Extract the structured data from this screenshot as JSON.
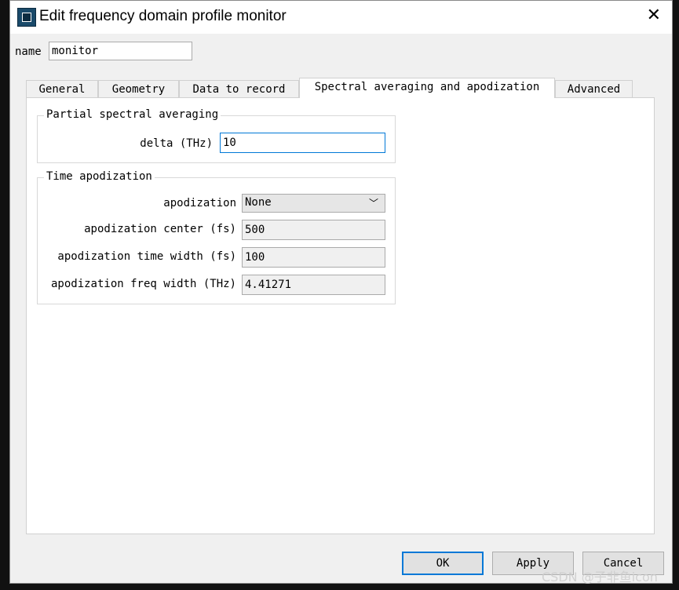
{
  "window": {
    "title": "Edit frequency domain profile monitor"
  },
  "name_field": {
    "label": "name",
    "value": "monitor"
  },
  "tabs": [
    {
      "label": "General"
    },
    {
      "label": "Geometry"
    },
    {
      "label": "Data to record"
    },
    {
      "label": "Spectral averaging and apodization",
      "active": true
    },
    {
      "label": "Advanced"
    }
  ],
  "partial": {
    "title": "Partial spectral averaging",
    "delta_label": "delta (THz)",
    "delta_value": "10"
  },
  "apod": {
    "title": "Time apodization",
    "apodization_label": "apodization",
    "apodization_value": "None",
    "center_label": "apodization center (fs)",
    "center_value": "500",
    "time_width_label": "apodization time width (fs)",
    "time_width_value": "100",
    "freq_width_label": "apodization freq width (THz)",
    "freq_width_value": "4.41271"
  },
  "buttons": {
    "ok": "OK",
    "apply": "Apply",
    "cancel": "Cancel"
  },
  "watermark": "CSDN @子非鱼icon"
}
